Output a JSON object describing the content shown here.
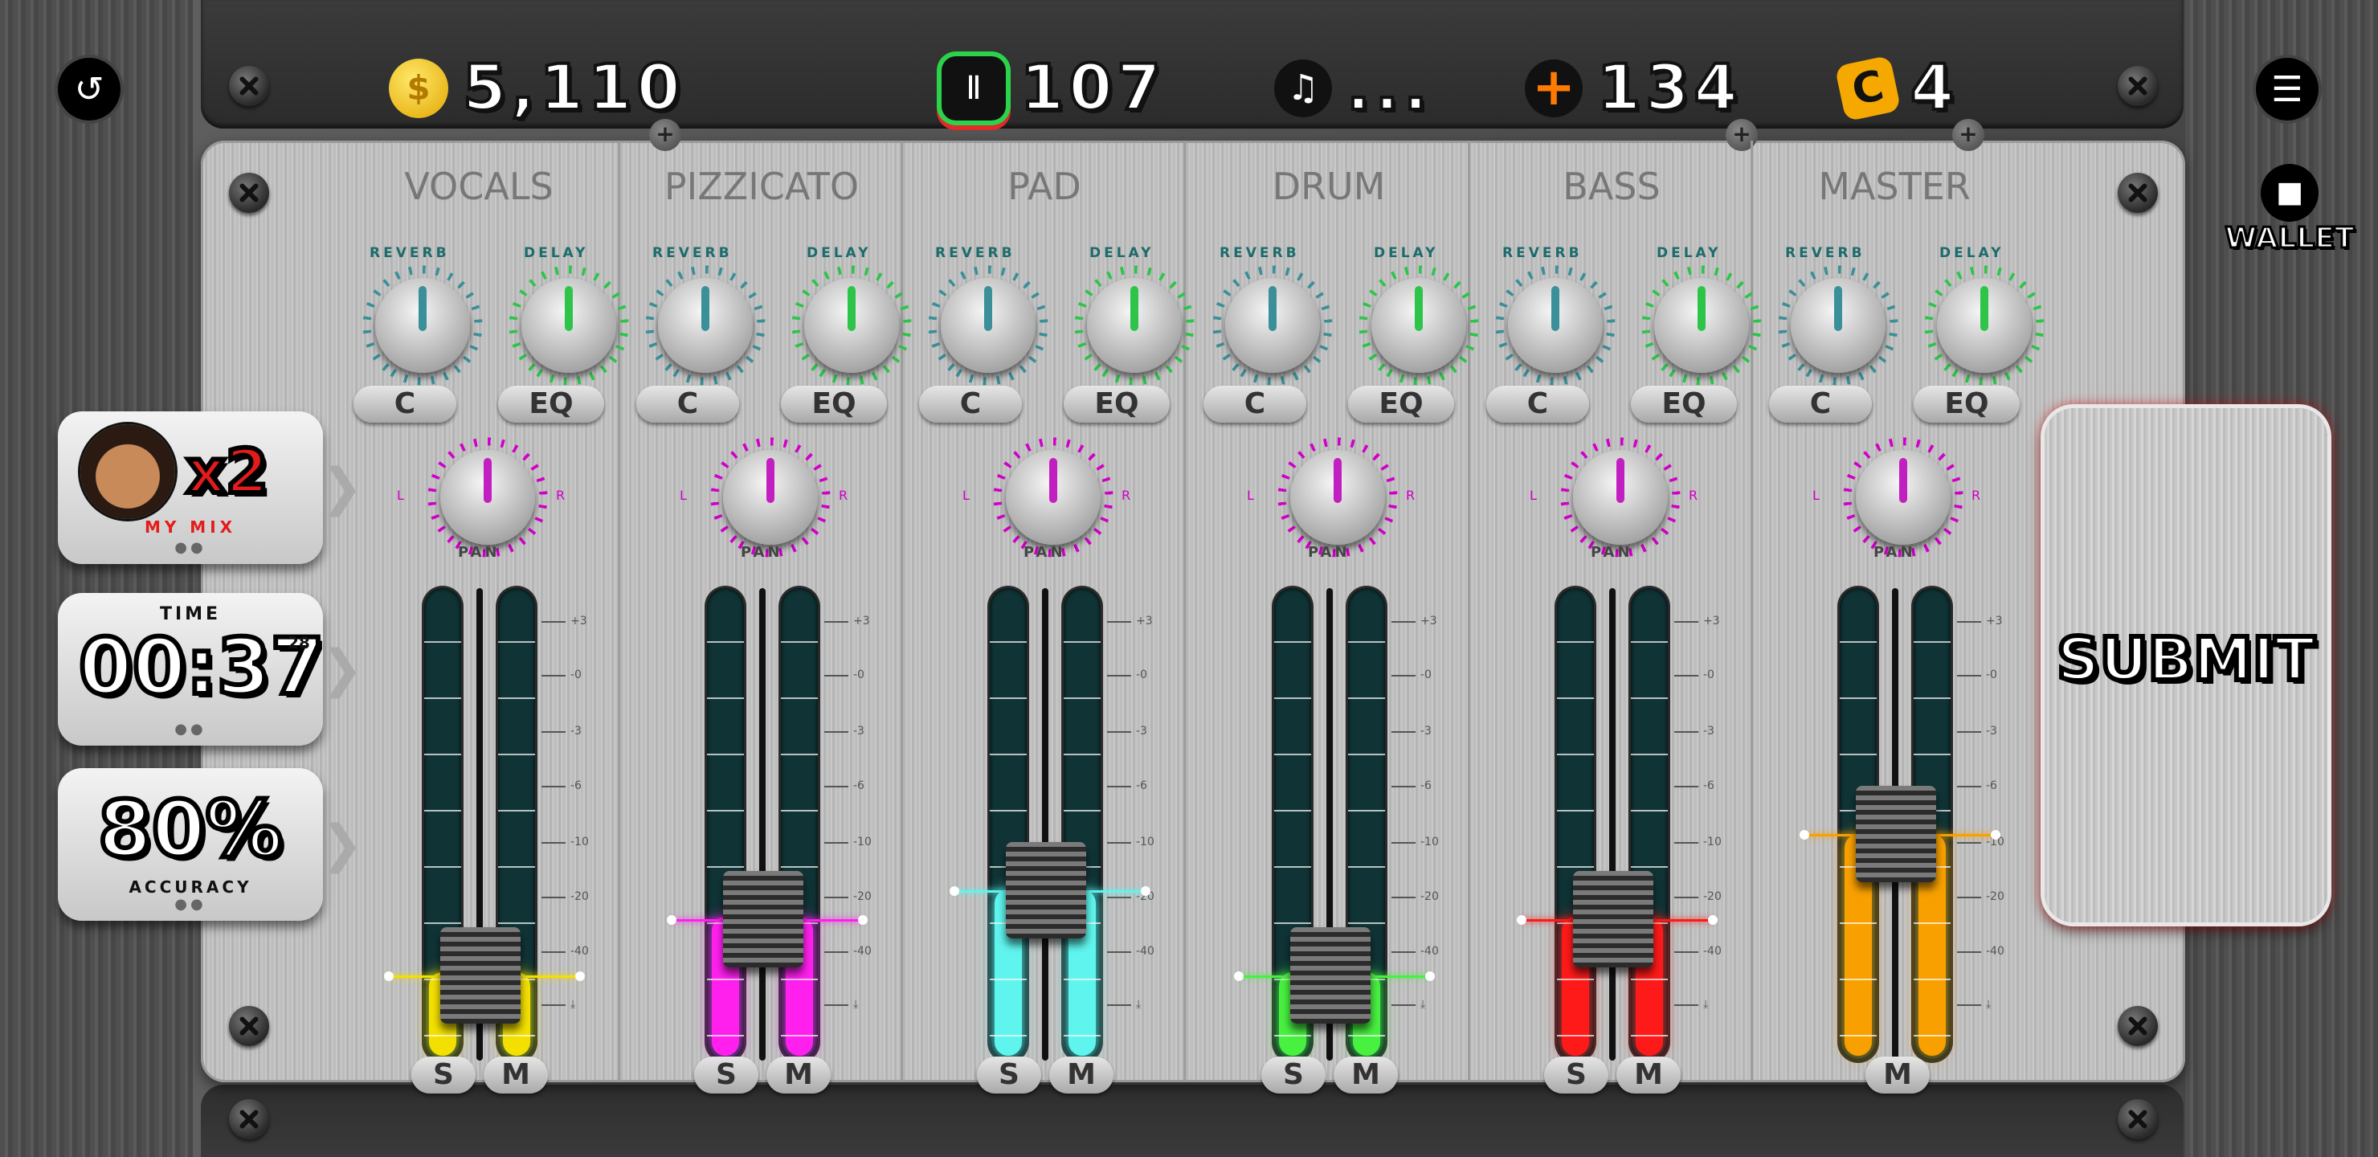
{
  "hud": {
    "coins": "5,110",
    "sound_points": "107",
    "song": "...",
    "health": "134",
    "credits": "4"
  },
  "wallet_label": "WALLET",
  "cards": {
    "mix": {
      "multiplier": "x2",
      "label": "MY MIX"
    },
    "time": {
      "label": "TIME",
      "value": "00:37",
      "suffix": "28"
    },
    "accuracy": {
      "value": "80%",
      "label": "ACCURACY"
    }
  },
  "submit_label": "SUBMIT",
  "knob_labels": {
    "reverb": "REVERB",
    "delay": "DELAY",
    "pan": "PAN",
    "left": "L",
    "right": "R"
  },
  "scale_labels": [
    "+3",
    "-0",
    "-3",
    "-6",
    "-10",
    "-20",
    "-40",
    "⤓"
  ],
  "channels": [
    {
      "name": "VOCALS",
      "c": "C",
      "eq": "EQ",
      "solo": "S",
      "mute": "M",
      "color": "#f4e000",
      "level": 0.18
    },
    {
      "name": "PIZZICATO",
      "c": "C",
      "eq": "EQ",
      "solo": "S",
      "mute": "M",
      "color": "#ff20ee",
      "level": 0.3
    },
    {
      "name": "PAD",
      "c": "C",
      "eq": "EQ",
      "solo": "S",
      "mute": "M",
      "color": "#5ff5ee",
      "level": 0.36
    },
    {
      "name": "DRUM",
      "c": "C",
      "eq": "EQ",
      "solo": "S",
      "mute": "M",
      "color": "#48f040",
      "level": 0.18
    },
    {
      "name": "BASS",
      "c": "C",
      "eq": "EQ",
      "solo": "S",
      "mute": "M",
      "color": "#ff1a1a",
      "level": 0.3
    },
    {
      "name": "MASTER",
      "c": "C",
      "eq": "EQ",
      "solo": "",
      "mute": "M",
      "color": "#f8a000",
      "level": 0.48
    }
  ]
}
